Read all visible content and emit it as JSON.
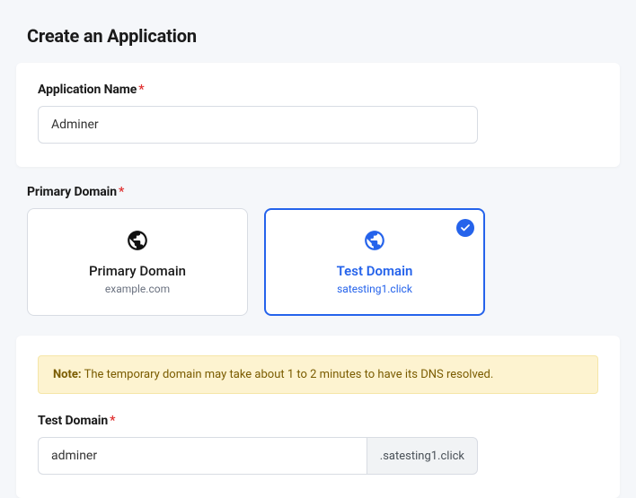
{
  "page": {
    "title": "Create an Application"
  },
  "appName": {
    "label": "Application Name",
    "required": "*",
    "value": "Adminer"
  },
  "primaryDomain": {
    "label": "Primary Domain",
    "required": "*",
    "options": [
      {
        "title": "Primary Domain",
        "sub": "example.com"
      },
      {
        "title": "Test Domain",
        "sub": "satesting1.click"
      }
    ]
  },
  "note": {
    "prefix": "Note:",
    "text": " The temporary domain may take about 1 to 2 minutes to have its DNS resolved."
  },
  "testDomain": {
    "label": "Test Domain",
    "required": "*",
    "value": "adminer",
    "suffix": ".satesting1.click"
  }
}
